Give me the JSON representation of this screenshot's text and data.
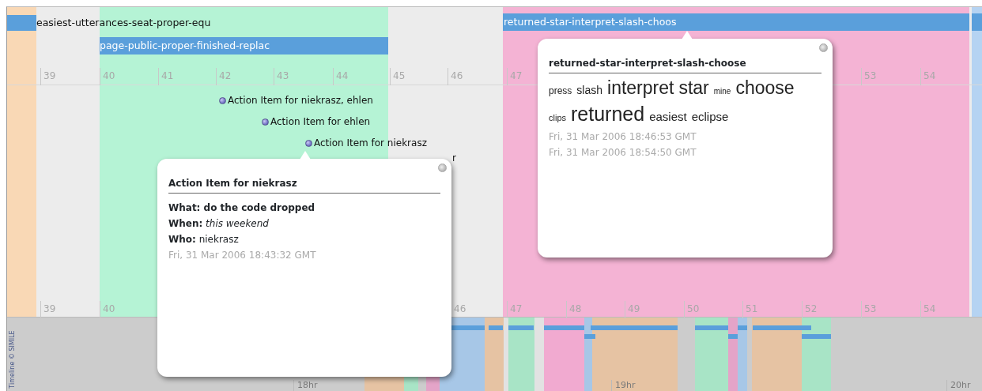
{
  "timeline": {
    "duration_events": [
      {
        "label": "easiest-utterances-seat-proper-equ"
      },
      {
        "label": "page-public-proper-finished-replac"
      },
      {
        "label": "returned-star-interpret-slash-choos"
      }
    ],
    "instant_events": [
      {
        "label": "Action Item for niekrasz, ehlen"
      },
      {
        "label": "Action Item for ehlen"
      },
      {
        "label": "Action Item for niekrasz"
      },
      {
        "label": "r"
      }
    ],
    "upper_ticks": [
      "39",
      "40",
      "41",
      "42",
      "43",
      "44",
      "45",
      "46",
      "47",
      "53",
      "54"
    ],
    "lower_ticks": [
      "39",
      "40",
      "46",
      "47",
      "48",
      "49",
      "50",
      "51",
      "52",
      "53",
      "54"
    ],
    "overview_ticks": [
      "18hr",
      "19hr",
      "20hr"
    ],
    "credit": "Timeline © SIMILE"
  },
  "popups": [
    {
      "kind": "action",
      "title": "Action Item for niekrasz",
      "lines": [
        "**What: do the code dropped**",
        "**When:** *this weekend*",
        "**Who:** niekrasz"
      ],
      "dates": [
        "Fri, 31 Mar 2006 18:43:32 GMT"
      ]
    },
    {
      "kind": "cloud",
      "title": "returned-star-interpret-slash-choose",
      "words": [
        "press",
        "slash",
        "interpret",
        "star",
        "mine",
        "choose",
        "clips",
        "returned",
        "easiest",
        "eclipse"
      ],
      "dates": [
        "Fri, 31 Mar 2006 18:46:53 GMT",
        "Fri, 31 Mar 2006 18:54:50 GMT"
      ]
    }
  ]
}
